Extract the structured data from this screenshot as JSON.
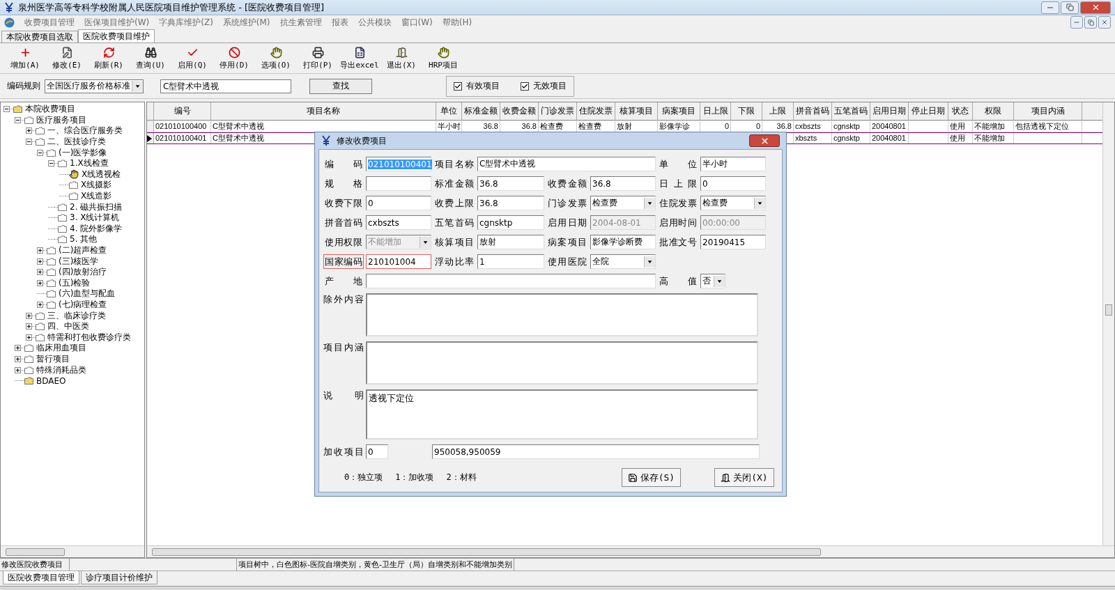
{
  "window": {
    "title": "泉州医学高等专科学校附属人民医院项目维护管理系统 - [医院收费项目管理]"
  },
  "menu": [
    "收费项目管理",
    "医保项目维护(W)",
    "字典库维护(Z)",
    "系统维护(M)",
    "抗生素管理",
    "报表",
    "公共模块",
    "窗口(W)",
    "帮助(H)"
  ],
  "tabs": [
    {
      "label": "本院收费项目选取",
      "selected": false
    },
    {
      "label": "医院收费项目维护",
      "selected": true
    }
  ],
  "toolbar": [
    "增加(A)",
    "修改(E)",
    "刷新(R)",
    "查询(U)",
    "启用(Q)",
    "停用(D)",
    "选项(O)",
    "打印(P)",
    "导出excel",
    "退出(X)",
    "HRP项目"
  ],
  "search": {
    "rule_label": "编码规则",
    "rule_value": "全国医疗服务价格标准",
    "query": "C型臂术中透视",
    "find_button": "查找",
    "filters": [
      {
        "label": "有效项目",
        "checked": true
      },
      {
        "label": "无效项目",
        "checked": true
      }
    ]
  },
  "tree": [
    {
      "label": "本院收费项目",
      "kind": "category",
      "expanded": true,
      "children": [
        {
          "label": "医疗服务项目",
          "kind": "folder",
          "expanded": true,
          "children": [
            {
              "label": "一、综合医疗服务类",
              "kind": "folder",
              "expanded": false
            },
            {
              "label": "二、医技诊疗类",
              "kind": "folder",
              "expanded": true,
              "children": [
                {
                  "label": "(一)医学影像",
                  "kind": "folder",
                  "expanded": true,
                  "children": [
                    {
                      "label": "1.X线检查",
                      "kind": "folder",
                      "expanded": true,
                      "children": [
                        {
                          "label": "X线透视检",
                          "kind": "current"
                        },
                        {
                          "label": "X线摄影",
                          "kind": "folder"
                        },
                        {
                          "label": "X线造影",
                          "kind": "folder"
                        }
                      ]
                    },
                    {
                      "label": "2. 磁共振扫描",
                      "kind": "folder"
                    },
                    {
                      "label": "3. X线计算机",
                      "kind": "folder"
                    },
                    {
                      "label": "4. 院外影像学",
                      "kind": "folder"
                    },
                    {
                      "label": "5. 其他",
                      "kind": "folder"
                    }
                  ]
                },
                {
                  "label": "(二)超声检查",
                  "kind": "folder",
                  "expanded": false
                },
                {
                  "label": "(三)核医学",
                  "kind": "folder",
                  "expanded": false
                },
                {
                  "label": "(四)放射治疗",
                  "kind": "folder",
                  "expanded": false
                },
                {
                  "label": "(五)检验",
                  "kind": "folder",
                  "expanded": false
                },
                {
                  "label": "(六)血型与配血",
                  "kind": "folder"
                },
                {
                  "label": "(七)病理检查",
                  "kind": "folder",
                  "expanded": false
                }
              ]
            },
            {
              "label": "三、临床诊疗类",
              "kind": "folder",
              "expanded": false
            },
            {
              "label": "四、中医类",
              "kind": "folder",
              "expanded": false
            },
            {
              "label": "特需和打包收费诊疗类",
              "kind": "folder",
              "expanded": false
            }
          ]
        },
        {
          "label": "临床用血项目",
          "kind": "folder",
          "expanded": false
        },
        {
          "label": "暂行项目",
          "kind": "folder",
          "expanded": false
        },
        {
          "label": "特殊消耗品类",
          "kind": "folder",
          "expanded": false
        },
        {
          "label": "BDAEO",
          "kind": "category"
        }
      ]
    }
  ],
  "table": {
    "columns": [
      "编号",
      "项目名称",
      "单位",
      "标准金额",
      "收费金额",
      "门诊发票",
      "住院发票",
      "核算项目",
      "病案项目",
      "日上限",
      "下限",
      "上限",
      "拼音首码",
      "五笔首码",
      "启用日期",
      "停止日期",
      "状态",
      "权限",
      "项目内涵"
    ],
    "rows": [
      {
        "selected": false,
        "cells": [
          "021010100400",
          "C型臂术中透视",
          "半小时",
          "36.8",
          "36.8",
          "检查费",
          "检查费",
          "放射",
          "影像学诊",
          "0",
          "0",
          "36.8",
          "cxbszts",
          "cgnsktp",
          "20040801",
          null,
          "使用",
          "不能增加",
          "包括透视下定位"
        ]
      },
      {
        "selected": true,
        "cells": [
          "021010100401",
          "C型臂术中透视",
          null,
          null,
          null,
          null,
          null,
          null,
          null,
          null,
          null,
          null,
          "xbszts",
          "cgnsktp",
          "20040801",
          null,
          "使用",
          "不能增加",
          null
        ]
      }
    ]
  },
  "dialog": {
    "title": "修改收费项目",
    "fields": [
      {
        "label": "编 码",
        "value": "021010100401",
        "kind": "text",
        "disabled": false,
        "selected": true,
        "flagged": false
      },
      {
        "label": "项目名称",
        "value": "C型臂术中透视",
        "kind": "text",
        "disabled": false,
        "selected": false,
        "flagged": false
      },
      {
        "label": "单 位",
        "value": "半小时",
        "kind": "text",
        "disabled": false,
        "selected": false,
        "flagged": false
      },
      {
        "label": "规 格",
        "kind": "text",
        "disabled": false,
        "flagged": false
      },
      {
        "label": "标准金额",
        "value": "36.8",
        "kind": "text",
        "disabled": false,
        "selected": false,
        "flagged": false
      },
      {
        "label": "收费金额",
        "value": "36.8",
        "kind": "text",
        "disabled": false,
        "selected": false,
        "flagged": false
      },
      {
        "label": "日上限",
        "value": "0",
        "kind": "text",
        "disabled": false,
        "selected": false,
        "flagged": false
      },
      {
        "label": "收费下限",
        "value": "0",
        "kind": "text",
        "disabled": false,
        "selected": false,
        "flagged": false
      },
      {
        "label": "收费上限",
        "value": "36.8",
        "kind": "text",
        "disabled": false,
        "selected": false,
        "flagged": false
      },
      {
        "label": "门诊发票",
        "value": "检查费",
        "kind": "select",
        "disabled": false,
        "flagged": false
      },
      {
        "label": "住院发票",
        "value": "检查费",
        "kind": "select",
        "disabled": false,
        "flagged": false
      },
      {
        "label": "拼音首码",
        "value": "cxbszts",
        "kind": "text",
        "disabled": false,
        "selected": false,
        "flagged": false
      },
      {
        "label": "五笔首码",
        "value": "cgnsktp",
        "kind": "text",
        "disabled": false,
        "selected": false,
        "flagged": false
      },
      {
        "label": "启用日期",
        "value": "2004-08-01",
        "kind": "text",
        "disabled": true,
        "selected": false,
        "flagged": false
      },
      {
        "label": "启用时间",
        "value": "00:00:00",
        "kind": "text",
        "disabled": true,
        "selected": false,
        "flagged": false
      },
      {
        "label": "使用权限",
        "value": "不能增加",
        "kind": "select",
        "disabled": true,
        "flagged": false
      },
      {
        "label": "核算项目",
        "value": "放射",
        "kind": "text",
        "disabled": false,
        "selected": false,
        "flagged": false
      },
      {
        "label": "病案项目",
        "value": "影像学诊断费",
        "kind": "text",
        "disabled": false,
        "selected": false,
        "flagged": false
      },
      {
        "label": "批准文号",
        "value": "20190415",
        "kind": "text",
        "disabled": false,
        "selected": false,
        "flagged": false
      },
      {
        "label": "国家编码",
        "value": "210101004",
        "kind": "text",
        "disabled": false,
        "selected": false,
        "flagged": true
      },
      {
        "label": "浮动比率",
        "value": "1",
        "kind": "text",
        "disabled": false,
        "selected": false,
        "flagged": false
      },
      {
        "label": "使用医院",
        "value": "全院",
        "kind": "select",
        "disabled": false,
        "flagged": false
      },
      {
        "label": "产 地",
        "kind": "text",
        "disabled": false,
        "flagged": false
      },
      {
        "label": "高值",
        "value": "否",
        "kind": "select",
        "disabled": false,
        "flagged": false
      }
    ],
    "areas": [
      {
        "label": "除外内容"
      },
      {
        "label": "项目内涵"
      },
      {
        "label": "说 明",
        "value": "透视下定位"
      }
    ],
    "extra": {
      "label": "加收项目",
      "value": "0",
      "list": "950058,950059"
    },
    "legend": [
      "0：独立项",
      "1：加收项",
      "2：材料"
    ],
    "buttons": [
      "保存(S)",
      "关闭(X)"
    ]
  },
  "status_bar": [
    "修改医院收费项目",
    "项目树中，白色图标-医院自增类别，黄色-卫生厅（局）自增类别和不能增加类别"
  ],
  "bottom_tabs": [
    {
      "label": "医院收费项目管理",
      "selected": true
    },
    {
      "label": "诊疗项目计价维护",
      "selected": false
    }
  ]
}
